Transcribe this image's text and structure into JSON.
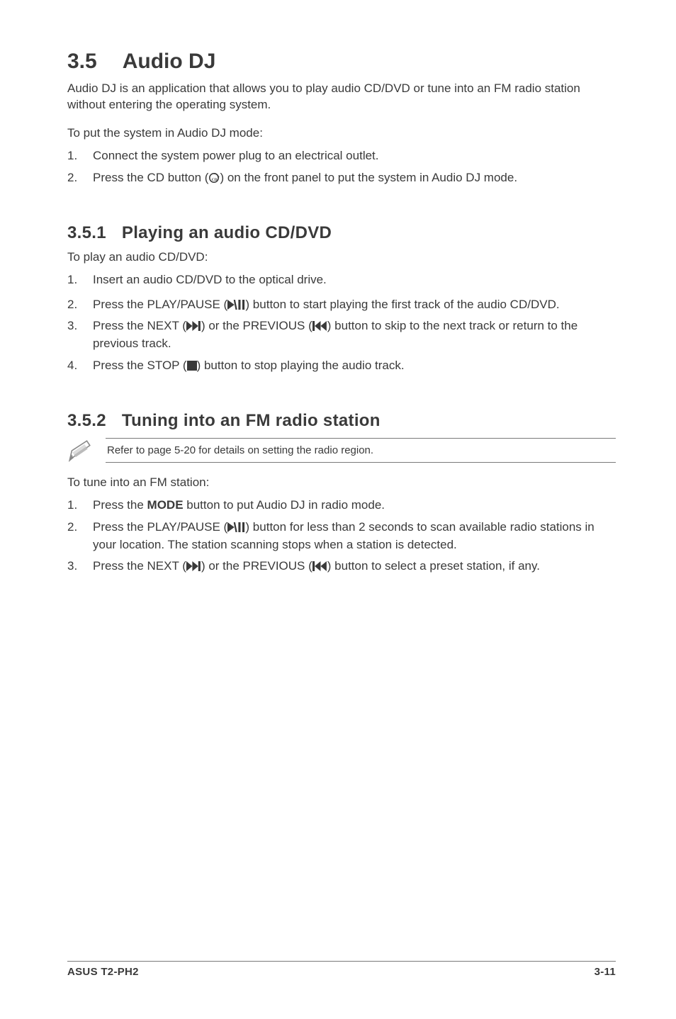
{
  "title": {
    "num": "3.5",
    "text": "Audio DJ"
  },
  "intro": "Audio DJ is an application that allows you to play audio CD/DVD or tune into an FM radio station without entering the operating system.",
  "lead0": "To put the system in Audio DJ mode:",
  "steps0": {
    "s1": "Connect the system power plug to an electrical outlet.",
    "s2a": "Press the CD button (",
    "s2b": ") on the front panel to put the system in Audio DJ mode."
  },
  "sec1": {
    "num": "3.5.1",
    "title": "Playing an audio CD/DVD"
  },
  "lead1": "To play an audio CD/DVD:",
  "steps1": {
    "s1": "Insert an audio CD/DVD to the optical drive.",
    "s2a": "Press the PLAY/PAUSE (",
    "s2b": ") button to start playing the first track of the audio CD/DVD.",
    "s3a": "Press the NEXT (",
    "s3b": ") or the PREVIOUS (",
    "s3c": ") button to skip to the next track or return to the previous track.",
    "s4a": "Press the STOP (",
    "s4b": ") button to stop playing the audio track."
  },
  "sec2": {
    "num": "3.5.2",
    "title": "Tuning into an FM radio station"
  },
  "note2": "Refer to page 5-20 for details on setting the radio region.",
  "lead2": "To tune into an FM station:",
  "steps2": {
    "s1a": "Press the ",
    "s1_mode": "MODE",
    "s1b": " button to put Audio DJ in radio mode.",
    "s2a": "Press the PLAY/PAUSE (",
    "s2b": ") button for less than 2 seconds to scan available radio stations in your location. The station scanning stops when a station is detected.",
    "s3a": "Press the NEXT (",
    "s3b": ") or the PREVIOUS (",
    "s3c": ") button to select a preset station, if any."
  },
  "footer": {
    "left": "ASUS T2-PH2",
    "right": "3-11"
  },
  "labels": {
    "n1": "1.",
    "n2": "2.",
    "n3": "3.",
    "n4": "4."
  }
}
